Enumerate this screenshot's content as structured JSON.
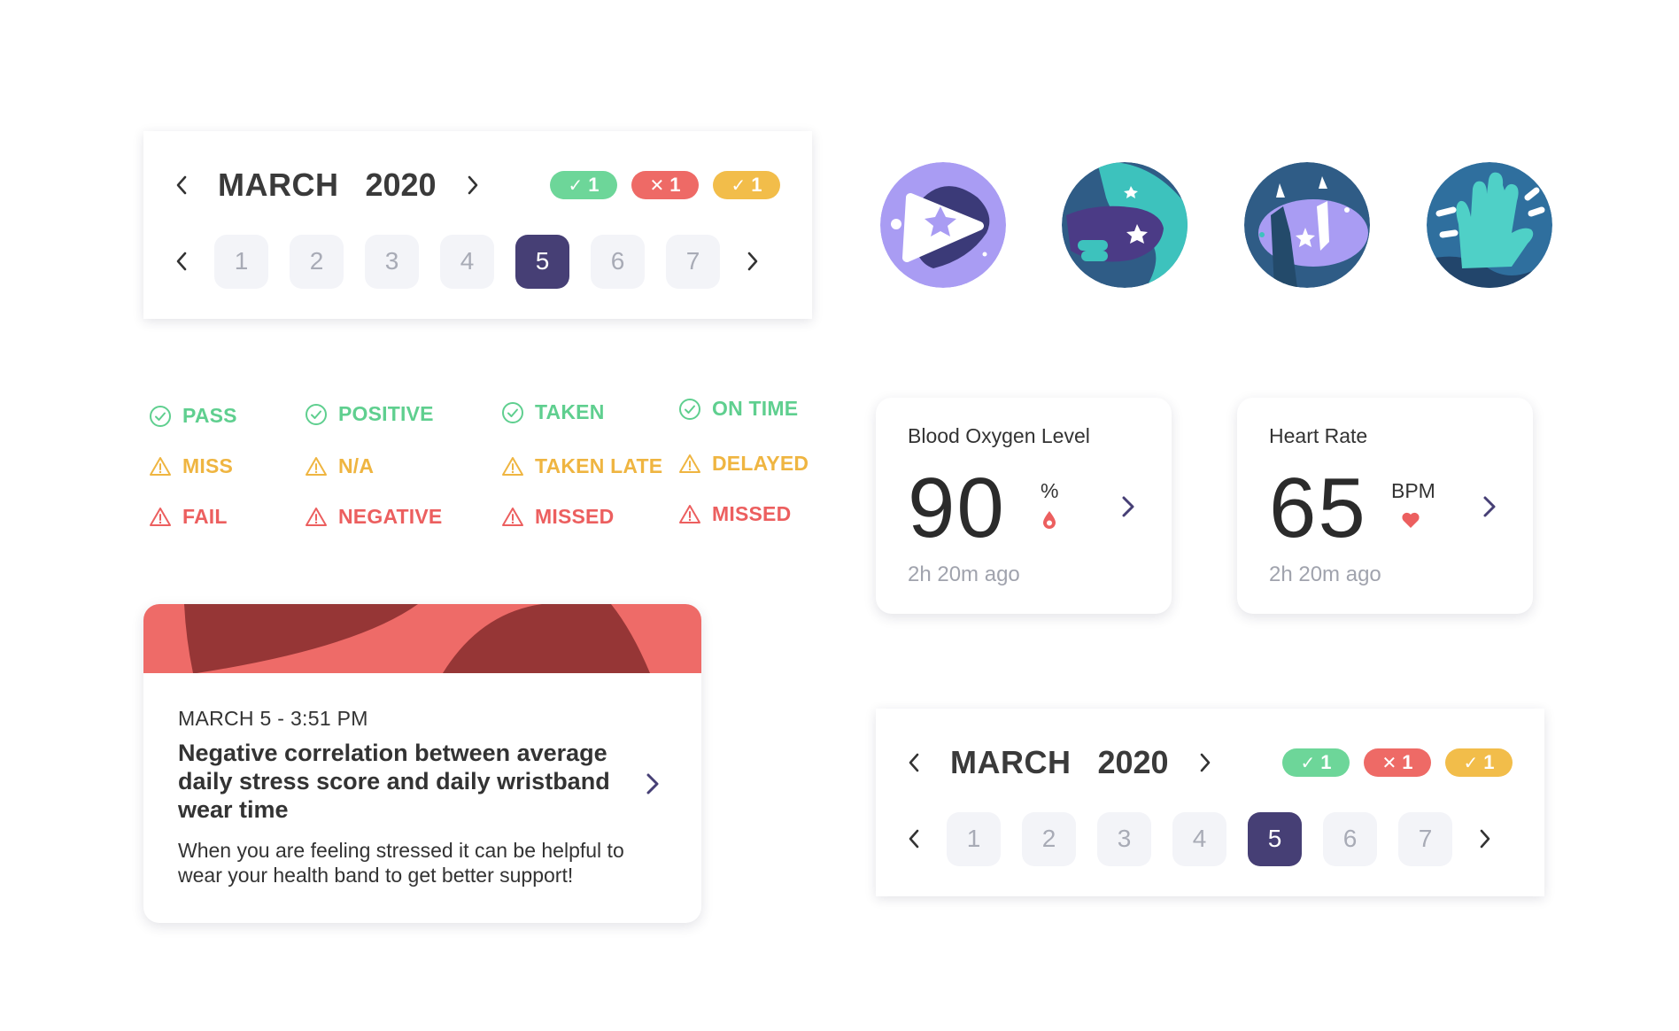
{
  "calendars": [
    {
      "month": "MARCH",
      "year": "2020",
      "badges": [
        {
          "symbol": "✓",
          "count": "1",
          "color": "#6dd699"
        },
        {
          "symbol": "✕",
          "count": "1",
          "color": "#ee6a66"
        },
        {
          "symbol": "✓",
          "count": "1",
          "color": "#f2bd4a"
        }
      ],
      "days": [
        "1",
        "2",
        "3",
        "4",
        "5",
        "6",
        "7"
      ],
      "selected_day": "5"
    },
    {
      "month": "MARCH",
      "year": "2020",
      "badges": [
        {
          "symbol": "✓",
          "count": "1",
          "color": "#6dd699"
        },
        {
          "symbol": "✕",
          "count": "1",
          "color": "#ee6a66"
        },
        {
          "symbol": "✓",
          "count": "1",
          "color": "#f2bd4a"
        }
      ],
      "days": [
        "1",
        "2",
        "3",
        "4",
        "5",
        "6",
        "7"
      ],
      "selected_day": "5"
    }
  ],
  "illustrations": [
    "play-star-icon",
    "hand-star-icon",
    "hands-up-icon",
    "raised-hand-icon"
  ],
  "status_groups": [
    {
      "pass": "PASS",
      "miss": "MISS",
      "fail": "FAIL"
    },
    {
      "pass": "POSITIVE",
      "miss": "N/A",
      "fail": "NEGATIVE"
    },
    {
      "pass": "TAKEN",
      "miss": "TAKEN LATE",
      "fail": "MISSED"
    },
    {
      "pass": "ON TIME",
      "miss": "DELAYED",
      "fail": "MISSED"
    }
  ],
  "status_colors": {
    "pass": "#5fcf8f",
    "miss": "#efb541",
    "fail": "#ec5f5f"
  },
  "metrics": [
    {
      "title": "Blood Oxygen Level",
      "value": "90",
      "unit": "%",
      "icon": "drop-icon",
      "ago": "2h 20m ago"
    },
    {
      "title": "Heart Rate",
      "value": "65",
      "unit": "BPM",
      "icon": "heart-icon",
      "ago": "2h 20m ago"
    }
  ],
  "insight": {
    "date": "MARCH 5 - 3:51 PM",
    "headline": "Negative correlation between average daily stress score and daily wristband wear time",
    "body": "When you are feeling stressed it can be helpful to wear your health band to get better support!",
    "banner_colors": [
      "#ee6b68",
      "#963636"
    ]
  },
  "colors": {
    "accent": "#463f75",
    "text": "#333333",
    "muted": "#a0a3ad"
  }
}
